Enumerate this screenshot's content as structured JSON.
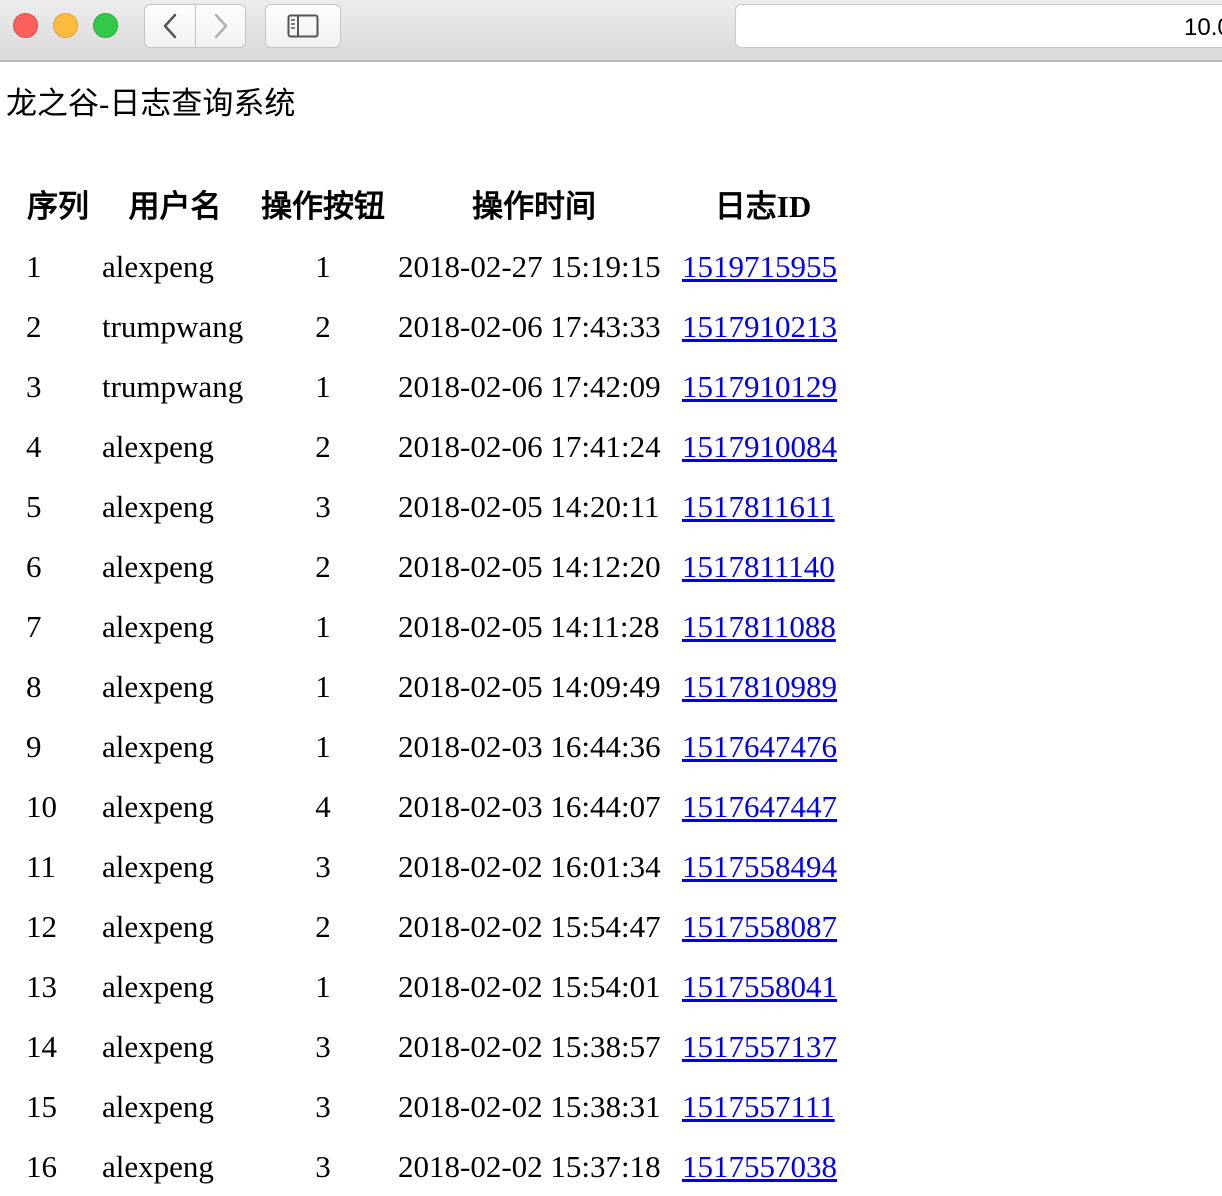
{
  "browser": {
    "url": "10.0",
    "back_icon": "chevron-left-icon",
    "forward_icon": "chevron-right-icon",
    "sidebar_icon": "sidebar-icon",
    "traffic_light_colors": {
      "close": "#fc605c",
      "minimize": "#fdbc40",
      "zoom": "#34c84a"
    }
  },
  "page": {
    "title": "龙之谷-日志查询系统"
  },
  "table": {
    "headers": [
      "序列",
      "用户名",
      "操作按钮",
      "操作时间",
      "日志ID"
    ],
    "rows": [
      [
        "1",
        "alexpeng",
        "1",
        "2018-02-27 15:19:15",
        "1519715955"
      ],
      [
        "2",
        "trumpwang",
        "2",
        "2018-02-06 17:43:33",
        "1517910213"
      ],
      [
        "3",
        "trumpwang",
        "1",
        "2018-02-06 17:42:09",
        "1517910129"
      ],
      [
        "4",
        "alexpeng",
        "2",
        "2018-02-06 17:41:24",
        "1517910084"
      ],
      [
        "5",
        "alexpeng",
        "3",
        "2018-02-05 14:20:11",
        "1517811611"
      ],
      [
        "6",
        "alexpeng",
        "2",
        "2018-02-05 14:12:20",
        "1517811140"
      ],
      [
        "7",
        "alexpeng",
        "1",
        "2018-02-05 14:11:28",
        "1517811088"
      ],
      [
        "8",
        "alexpeng",
        "1",
        "2018-02-05 14:09:49",
        "1517810989"
      ],
      [
        "9",
        "alexpeng",
        "1",
        "2018-02-03 16:44:36",
        "1517647476"
      ],
      [
        "10",
        "alexpeng",
        "4",
        "2018-02-03 16:44:07",
        "1517647447"
      ],
      [
        "11",
        "alexpeng",
        "3",
        "2018-02-02 16:01:34",
        "1517558494"
      ],
      [
        "12",
        "alexpeng",
        "2",
        "2018-02-02 15:54:47",
        "1517558087"
      ],
      [
        "13",
        "alexpeng",
        "1",
        "2018-02-02 15:54:01",
        "1517558041"
      ],
      [
        "14",
        "alexpeng",
        "3",
        "2018-02-02 15:38:57",
        "1517557137"
      ],
      [
        "15",
        "alexpeng",
        "3",
        "2018-02-02 15:38:31",
        "1517557111"
      ],
      [
        "16",
        "alexpeng",
        "3",
        "2018-02-02 15:37:18",
        "1517557038"
      ]
    ],
    "link_color": "#0000ee"
  }
}
